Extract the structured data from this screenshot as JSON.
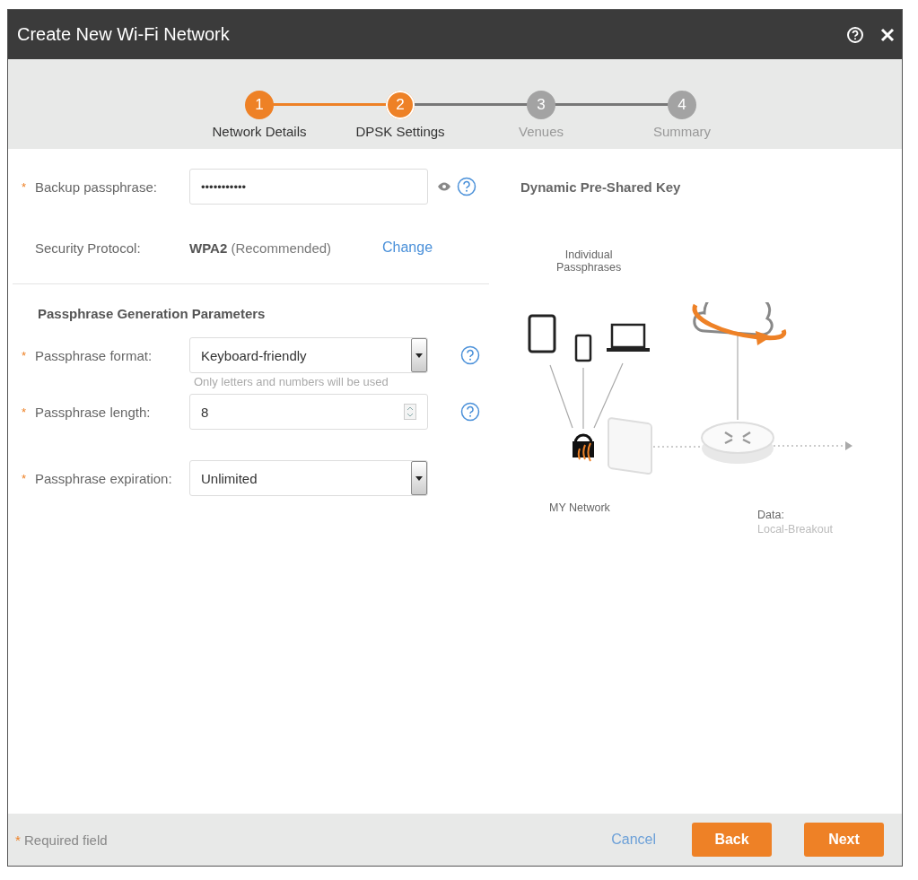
{
  "window": {
    "title": "Create New Wi-Fi Network"
  },
  "steps": [
    {
      "number": "1",
      "label": "Network Details",
      "completed": true,
      "selected": false
    },
    {
      "number": "2",
      "label": "DPSK Settings",
      "completed": false,
      "selected": true
    },
    {
      "number": "3",
      "label": "Venues",
      "completed": false,
      "selected": false
    },
    {
      "number": "4",
      "label": "Summary",
      "completed": false,
      "selected": false
    }
  ],
  "backup": {
    "marker": "*",
    "label": "Backup passphrase:",
    "value": "•••••••••••",
    "reveal": true,
    "help": true
  },
  "security": {
    "label": "Security Protocol:",
    "value": "**WPA2** (Recommended)",
    "link": "Change"
  },
  "section_title": "Passphrase Generation Parameters",
  "fields": [
    {
      "kind": "select",
      "marker": "*",
      "label": "Passphrase format:",
      "value": "Keyboard-friendly",
      "hint": "Only letters and numbers will be used",
      "help": true
    },
    {
      "kind": "number",
      "marker": "*",
      "label": "Passphrase length:",
      "value": "8",
      "help": true
    },
    {
      "kind": "select",
      "marker": "*",
      "label": "Passphrase expiration:",
      "value": "Unlimited",
      "help": false
    }
  ],
  "info": {
    "title": "Dynamic Pre-Shared Key",
    "devices_label": "Individual\nPassphrases",
    "network_label": "MY Network",
    "data_label": "Data:",
    "data_value": "Local-Breakout"
  },
  "footer": {
    "required_mark": "*",
    "required_note": "Required field",
    "cancel": "Cancel",
    "back": "Back",
    "next": "Next"
  }
}
